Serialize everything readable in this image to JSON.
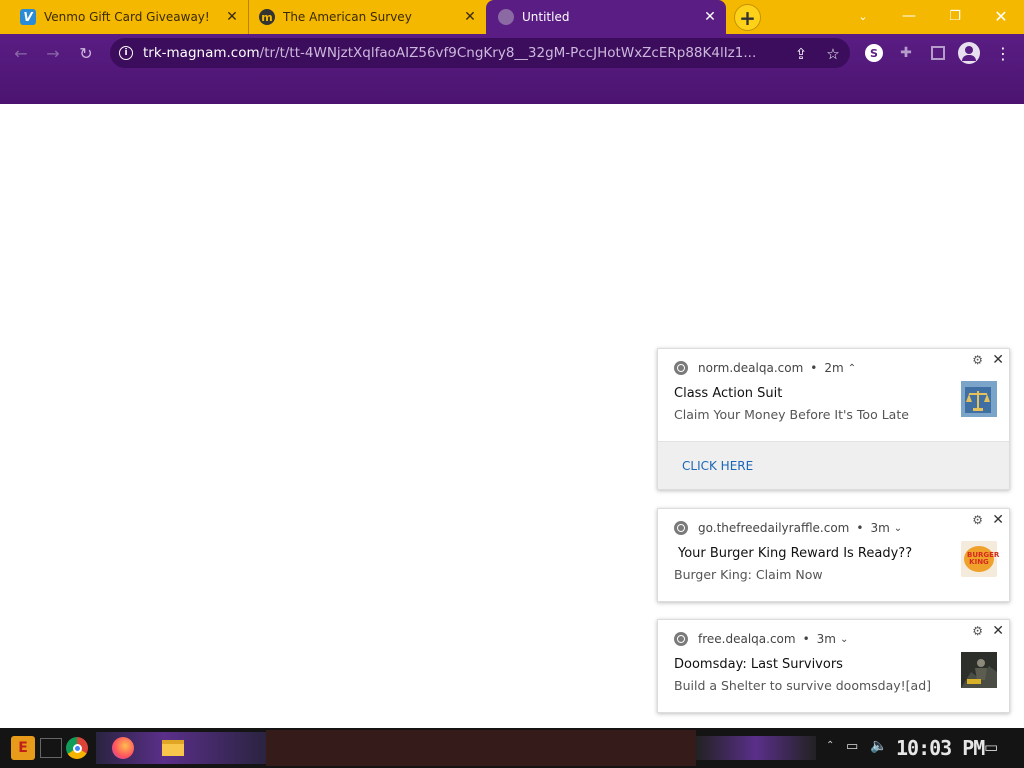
{
  "browser": {
    "tabs": [
      {
        "title": "Venmo Gift Card Giveaway!",
        "favicon": "venmo-icon"
      },
      {
        "title": "The American Survey",
        "favicon": "m-logo-icon"
      },
      {
        "title": "Untitled",
        "favicon": "globe-icon"
      }
    ],
    "url_domain": "trk-magnam.com",
    "url_path": "/tr/t/tt-4WNjztXqlfaoAIZ56vf9CngKry8__32gM-PccJHotWxZcERp88K4lIz1..."
  },
  "notifications": [
    {
      "source": "norm.dealqa.com",
      "age": "2m",
      "title": "Class Action Suit",
      "body": "Claim Your Money Before It's Too Late",
      "action": "CLICK HERE"
    },
    {
      "source": "go.thefreedailyraffle.com",
      "age": "3m",
      "title": "Your Burger King Reward Is Ready??",
      "body": "Burger King:  Claim Now",
      "thumb_text": "BURGER KING"
    },
    {
      "source": "free.dealqa.com",
      "age": "3m",
      "title": "Doomsday: Last Survivors",
      "body": "Build a Shelter to survive doomsday![ad]"
    }
  ],
  "taskbar": {
    "clock": "10:03 PM"
  },
  "colors": {
    "tab_strip": "#f5b800",
    "toolbar": "#5a1d84",
    "link": "#1a66b8"
  }
}
